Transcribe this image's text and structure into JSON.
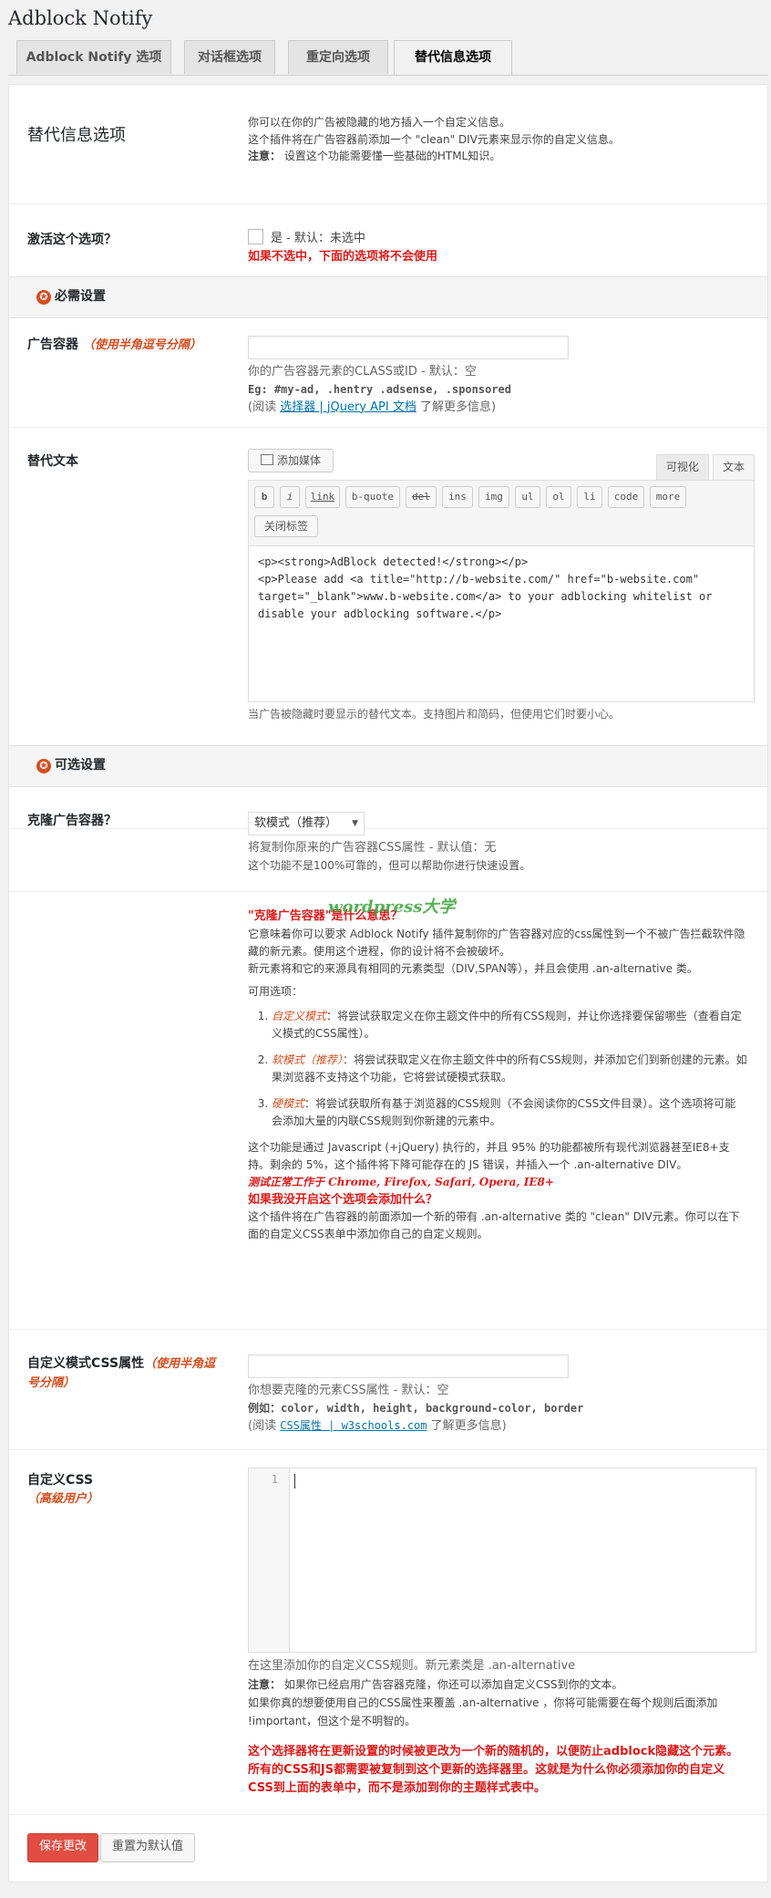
{
  "header": {
    "title": "Adblock Notify"
  },
  "tabs": [
    {
      "label": "Adblock Notify 选项"
    },
    {
      "label": "对话框选项"
    },
    {
      "label": "重定向选项"
    },
    {
      "label": "替代信息选项"
    }
  ],
  "intro": {
    "title": "替代信息选项",
    "line1": "你可以在你的广告被隐藏的地方插入一个自定义信息。",
    "line2": "这个插件将在广告容器前添加一个 \"clean\" DIV元素来显示你的自定义信息。",
    "note_label": "注意：",
    "note_text": "设置这个功能需要懂一些基础的HTML知识。"
  },
  "activate": {
    "label": "激活这个选项？",
    "checkbox_text": "是 - 默认：未选中",
    "warning": "如果不选中，下面的选项将不会使用"
  },
  "required_section": {
    "title": "必需设置"
  },
  "ad_container": {
    "label": "广告容器",
    "label_note": "（使用半角逗号分隔）",
    "value": "",
    "desc": "你的广告容器元素的CLASS或ID - 默认：空",
    "eg": "Eg: #my-ad, .hentry .adsense, .sponsored",
    "read_prefix": "(阅读 ",
    "read_link": "选择器 | jQuery API 文档",
    "read_suffix": " 了解更多信息)"
  },
  "alt_text": {
    "label": "替代文本",
    "add_media": "添加媒体",
    "tab_visual": "可视化",
    "tab_text": "文本",
    "buttons": [
      "b",
      "i",
      "link",
      "b-quote",
      "del",
      "ins",
      "img",
      "ul",
      "ol",
      "li",
      "code",
      "more"
    ],
    "close_tags": "关闭标签",
    "content_line1": "<p><strong>AdBlock detected!</strong></p>",
    "content_line2": "<p>Please add <a title=\"http://b-website.com/\" href=\"b-website.com\"",
    "content_line3": "target=\"_blank\">www.b-website.com</a> to your adblocking whitelist or",
    "content_line4": "disable your adblocking software.</p>",
    "desc": "当广告被隐藏时要显示的替代文本。支持图片和简码，但使用它们时要小心。"
  },
  "optional_section": {
    "title": "可选设置"
  },
  "clone": {
    "label": "克隆广告容器？",
    "selected": "软模式（推荐）",
    "desc1": "将复制你原来的广告容器CSS属性 - 默认值：无",
    "desc2": "这个功能不是100%可靠的，但可以帮助你进行快速设置。"
  },
  "clone_explain": {
    "heading": "\"克隆广告容器\"是什么意思？",
    "watermark": "wordpress大学",
    "p1": "它意味着你可以要求 Adblock Notify 插件复制你的广告容器对应的css属性到一个不被广告拦截软件隐藏的新元素。使用这个进程，你的设计将不会被破坏。",
    "p2": "新元素将和它的来源具有相同的元素类型（DIV,SPAN等），并且会使用 .an-alternative 类。",
    "options_title": "可用选项：",
    "opt1_name": "自定义模式",
    "opt1_text": "：将尝试获取定义在你主题文件中的所有CSS规则，并让你选择要保留哪些（查看自定义模式的CSS属性）。",
    "opt2_name": "软模式（推荐）",
    "opt2_text": "：将尝试获取定义在你主题文件中的所有CSS规则，并添加它们到新创建的元素。如果浏览器不支持这个功能，它将尝试硬模式获取。",
    "opt3_name": "硬模式",
    "opt3_text": "：将尝试获取所有基于浏览器的CSS规则（不会阅读你的CSS文件目录）。这个选项将可能 会添加大量的内联CSS规则到你新建的元素中。",
    "p3": "这个功能是通过 Javascript (+jQuery) 执行的，并且 95% 的功能都被所有现代浏览器甚至IE8+支持。剩余的 5%，这个插件将下降可能存在的 JS 错误，并插入一个 .an-alternative DIV。",
    "tested": "测试正常工作于 Chrome, Firefox, Safari, Opera, IE8+",
    "q": "如果我没开启这个选项会添加什么？",
    "answer": "这个插件将在广告容器的前面添加一个新的带有 .an-alternative 类的 \"clean\" DIV元素。你可以在下面的自定义CSS表单中添加你自己的自定义规则。"
  },
  "custom_css_props": {
    "label": "自定义模式CSS属性",
    "label_note": "（使用半角逗号分隔）",
    "value": "",
    "desc": "你想要克隆的元素CSS属性 - 默认：空",
    "eg_label": "例如：",
    "eg": "color, width, height, background-color, border",
    "read_prefix": "(阅读 ",
    "read_link": "CSS属性 | w3schools.com",
    "read_suffix": " 了解更多信息)"
  },
  "custom_css": {
    "label": "自定义CSS",
    "label_note": "（高级用户）",
    "line_no": "1",
    "desc1": "在这里添加你的自定义CSS规则。新元素类是 .an-alternative",
    "note_label": "注意：",
    "note_text": "如果你已经启用广告容器克隆，你还可以添加自定义CSS到你的文本。",
    "desc2": "如果你真的想要使用自己的CSS属性来覆盖 .an-alternative ，你将可能需要在每个规则后面添加 !important，但这个是不明智的。",
    "warning": "这个选择器将在更新设置的时候被更改为一个新的随机的，以便防止adblock隐藏这个元素。所有的CSS和JS都需要被复制到这个更新的选择器里。这就是为什么你必须添加你的自定义CSS到上面的表单中，而不是添加到你的主题样式表中。"
  },
  "actions": {
    "save": "保存更改",
    "reset": "重置为默认值"
  },
  "colors": {
    "accent": "#e14d43",
    "warning": "#dd1a1a",
    "link": "#0073aa"
  }
}
